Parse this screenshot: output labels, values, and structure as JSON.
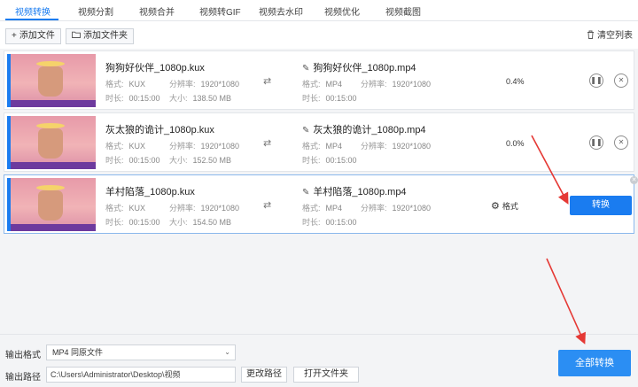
{
  "tabs": [
    {
      "label": "视频转换"
    },
    {
      "label": "视频分割"
    },
    {
      "label": "视频合并"
    },
    {
      "label": "视频转GIF"
    },
    {
      "label": "视频去水印"
    },
    {
      "label": "视频优化"
    },
    {
      "label": "视频截图"
    }
  ],
  "toolbar": {
    "add_file_label": "添加文件",
    "add_folder_label": "添加文件夹",
    "clear_list_label": "清空列表"
  },
  "labels": {
    "format": "格式:",
    "resolution": "分辨率:",
    "duration": "时长:",
    "size": "大小:",
    "format_setting": "格式",
    "convert": "转换"
  },
  "files": [
    {
      "name": "狗狗好伙伴_1080p.kux",
      "format": "KUX",
      "resolution": "1920*1080",
      "duration": "00:15:00",
      "size": "138.50 MB",
      "output_name": "狗狗好伙伴_1080p.mp4",
      "output_format": "MP4",
      "output_resolution": "1920*1080",
      "output_duration": "00:15:00",
      "progress": "0.4%"
    },
    {
      "name": "灰太狼的诡计_1080p.kux",
      "format": "KUX",
      "resolution": "1920*1080",
      "duration": "00:15:00",
      "size": "152.50 MB",
      "output_name": "灰太狼的诡计_1080p.mp4",
      "output_format": "MP4",
      "output_resolution": "1920*1080",
      "output_duration": "00:15:00",
      "progress": "0.0%"
    },
    {
      "name": "羊村陷落_1080p.kux",
      "format": "KUX",
      "resolution": "1920*1080",
      "duration": "00:15:00",
      "size": "154.50 MB",
      "output_name": "羊村陷落_1080p.mp4",
      "output_format": "MP4",
      "output_resolution": "1920*1080",
      "output_duration": "00:15:00"
    }
  ],
  "bottom": {
    "output_format_label": "输出格式",
    "output_format_value": "MP4  同原文件",
    "output_path_label": "输出路径",
    "output_path_value": "C:\\Users\\Administrator\\Desktop\\视频",
    "change_path_label": "更改路径",
    "open_folder_label": "打开文件夹",
    "convert_all_label": "全部转换"
  },
  "icons": {
    "add": "plus-icon",
    "folder": "folder-icon",
    "trash": "trash-icon",
    "rename": "pencil-icon",
    "convert_arrow": "shuffle-icon",
    "pause": "pause-icon",
    "remove": "close-icon",
    "settings": "gear-icon",
    "dropdown": "chevron-down-icon"
  },
  "colors": {
    "accent": "#1a7cf0",
    "convert_all": "#2b8ef3",
    "annotation": "#e53935"
  }
}
